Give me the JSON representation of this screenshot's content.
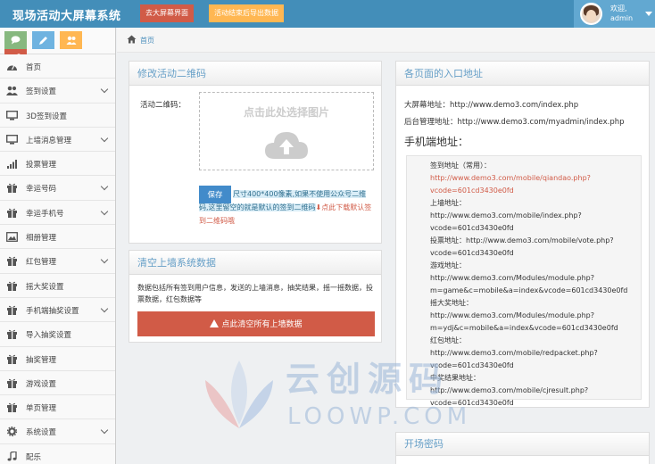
{
  "app": {
    "title": "现场活动大屏幕系统",
    "btn_big_screen": "去大屏幕界面",
    "btn_export": "活动结束后导出数据",
    "welcome": "欢迎,",
    "username": "admin"
  },
  "sidebar": {
    "items": [
      {
        "label": "首页",
        "icon": "dashboard-icon",
        "arrow": false
      },
      {
        "label": "签到设置",
        "icon": "users-icon",
        "arrow": true
      },
      {
        "label": "3D签到设置",
        "icon": "monitor-icon",
        "arrow": false
      },
      {
        "label": "上墙消息管理",
        "icon": "desktop-icon",
        "arrow": true
      },
      {
        "label": "投票管理",
        "icon": "bar-signal-icon",
        "arrow": false
      },
      {
        "label": "幸运号码",
        "icon": "gift-icon",
        "arrow": true
      },
      {
        "label": "幸运手机号",
        "icon": "gift-icon",
        "arrow": true
      },
      {
        "label": "相册管理",
        "icon": "picture-icon",
        "arrow": false
      },
      {
        "label": "红包管理",
        "icon": "gift-icon",
        "arrow": true
      },
      {
        "label": "摇大奖设置",
        "icon": "gift-icon",
        "arrow": false
      },
      {
        "label": "手机端抽奖设置",
        "icon": "gift-icon",
        "arrow": true
      },
      {
        "label": "导入抽奖设置",
        "icon": "gift-icon",
        "arrow": false
      },
      {
        "label": "抽奖管理",
        "icon": "gift-icon",
        "arrow": false
      },
      {
        "label": "游戏设置",
        "icon": "gift-icon",
        "arrow": false
      },
      {
        "label": "单页管理",
        "icon": "gift-icon",
        "arrow": false
      },
      {
        "label": "系统设置",
        "icon": "gear-icon",
        "arrow": true
      },
      {
        "label": "配乐",
        "icon": "music-icon",
        "arrow": false
      }
    ]
  },
  "breadcrumb": {
    "home": "首页"
  },
  "qr_panel": {
    "title": "修改活动二维码",
    "label": "活动二维码：",
    "upload_text": "点击此处选择图片",
    "save": "保存",
    "hint_main": "尺寸400*400像素,如果不使用公众号二维码,这里留空的就是默认的签到二维码",
    "hint_link": "点此下载默认签到二维码哦"
  },
  "clear_panel": {
    "title": "清空上墙系统数据",
    "desc": "数据包括所有签到用户信息，发送的上墙消息，抽奖结果，摇一摇数据，投票数据，红包数据等",
    "button": "点此清空所有上墙数据"
  },
  "entry_panel": {
    "title": "各页面的入口地址",
    "big_screen": "大屏幕地址：http://www.demo3.com/index.php",
    "admin": "后台管理地址：http://www.demo3.com/myadmin/index.php",
    "mobile_title": "手机端地址：",
    "urls": [
      {
        "text": "签到地址（常用）：",
        "red": false
      },
      {
        "text": "http://www.demo3.com/mobile/qiandao.php?",
        "red": true
      },
      {
        "text": "vcode=601cd3430e0fd",
        "red": true
      },
      {
        "text": "上墙地址：",
        "red": false
      },
      {
        "text": "http://www.demo3.com/mobile/index.php?",
        "red": false
      },
      {
        "text": "vcode=601cd3430e0fd",
        "red": false
      },
      {
        "text": "投票地址：http://www.demo3.com/mobile/vote.php?",
        "red": false
      },
      {
        "text": "vcode=601cd3430e0fd",
        "red": false
      },
      {
        "text": "游戏地址：",
        "red": false
      },
      {
        "text": "http://www.demo3.com/Modules/module.php?",
        "red": false
      },
      {
        "text": "m=game&c=mobile&a=index&vcode=601cd3430e0fd",
        "red": false
      },
      {
        "text": "摇大奖地址：",
        "red": false
      },
      {
        "text": "http://www.demo3.com/Modules/module.php?",
        "red": false
      },
      {
        "text": "m=ydj&c=mobile&a=index&vcode=601cd3430e0fd",
        "red": false
      },
      {
        "text": "红包地址：",
        "red": false
      },
      {
        "text": "http://www.demo3.com/mobile/redpacket.php?",
        "red": false
      },
      {
        "text": "vcode=601cd3430e0fd",
        "red": false
      },
      {
        "text": "中奖结果地址：",
        "red": false
      },
      {
        "text": "http://www.demo3.com/mobile/cjresult.php?",
        "red": false
      },
      {
        "text": "vcode=601cd3430e0fd",
        "red": false
      }
    ]
  },
  "pwd_panel": {
    "title": "开场密码"
  },
  "watermark": {
    "cn": "云创源码",
    "en": "LOOWP.COM"
  },
  "colors": {
    "topbar": "#438eb9",
    "danger": "#d15b47",
    "warning": "#ffb752",
    "primary": "#428bca"
  }
}
